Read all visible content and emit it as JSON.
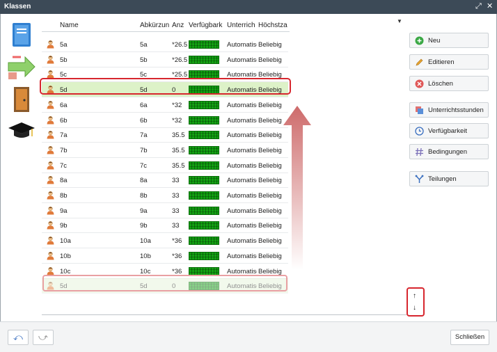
{
  "window": {
    "title": "Klassen",
    "maximize_icon": "expand-icon",
    "close_icon": "close-icon"
  },
  "nav_icons": [
    "book-icon",
    "transfer-icon",
    "door-icon",
    "graduation-cap-icon"
  ],
  "table": {
    "headers": [
      "Name",
      "Abkürzun",
      "Anz",
      "Verfügbark",
      "Unterrich",
      "Höchstza"
    ],
    "rows": [
      {
        "name": "5a",
        "abbr": "5a",
        "count": "*26.5",
        "unterricht": "Automatisc",
        "hoechst": "Beliebig"
      },
      {
        "name": "5b",
        "abbr": "5b",
        "count": "*26.5",
        "unterricht": "Automatisc",
        "hoechst": "Beliebig"
      },
      {
        "name": "5c",
        "abbr": "5c",
        "count": "*25.5",
        "unterricht": "Automatisc",
        "hoechst": "Beliebig"
      },
      {
        "name": "5d",
        "abbr": "5d",
        "count": "0",
        "unterricht": "Automatisc",
        "hoechst": "Beliebig"
      },
      {
        "name": "6a",
        "abbr": "6a",
        "count": "*32",
        "unterricht": "Automatisc",
        "hoechst": "Beliebig"
      },
      {
        "name": "6b",
        "abbr": "6b",
        "count": "*32",
        "unterricht": "Automatisc",
        "hoechst": "Beliebig"
      },
      {
        "name": "7a",
        "abbr": "7a",
        "count": "35.5",
        "unterricht": "Automatisc",
        "hoechst": "Beliebig"
      },
      {
        "name": "7b",
        "abbr": "7b",
        "count": "35.5",
        "unterricht": "Automatisc",
        "hoechst": "Beliebig"
      },
      {
        "name": "7c",
        "abbr": "7c",
        "count": "35.5",
        "unterricht": "Automatisc",
        "hoechst": "Beliebig"
      },
      {
        "name": "8a",
        "abbr": "8a",
        "count": "33",
        "unterricht": "Automatisc",
        "hoechst": "Beliebig"
      },
      {
        "name": "8b",
        "abbr": "8b",
        "count": "33",
        "unterricht": "Automatisc",
        "hoechst": "Beliebig"
      },
      {
        "name": "9a",
        "abbr": "9a",
        "count": "33",
        "unterricht": "Automatisc",
        "hoechst": "Beliebig"
      },
      {
        "name": "9b",
        "abbr": "9b",
        "count": "33",
        "unterricht": "Automatisc",
        "hoechst": "Beliebig"
      },
      {
        "name": "10a",
        "abbr": "10a",
        "count": "*36",
        "unterricht": "Automatisc",
        "hoechst": "Beliebig"
      },
      {
        "name": "10b",
        "abbr": "10b",
        "count": "*36",
        "unterricht": "Automatisc",
        "hoechst": "Beliebig"
      },
      {
        "name": "10c",
        "abbr": "10c",
        "count": "*36",
        "unterricht": "Automatisc",
        "hoechst": "Beliebig"
      }
    ],
    "selected_index": 3,
    "ghost_row": {
      "name": "5d",
      "abbr": "5d",
      "count": "0",
      "unterricht": "Automatisc",
      "hoechst": "Beliebig"
    }
  },
  "actions": [
    {
      "label": "Neu",
      "icon": "plus-circle-icon"
    },
    {
      "label": "Editieren",
      "icon": "pencil-icon"
    },
    {
      "label": "Löschen",
      "icon": "delete-circle-icon"
    },
    {
      "label": "Unterrichtsstunden",
      "icon": "lessons-icon"
    },
    {
      "label": "Verfügbarkeit",
      "icon": "clock-icon"
    },
    {
      "label": "Bedingungen",
      "icon": "hash-icon"
    },
    {
      "label": "Teilungen",
      "icon": "split-icon"
    }
  ],
  "reorder": {
    "up": "↑",
    "down": "↓"
  },
  "footer": {
    "undo": "⤺",
    "redo": "⤻",
    "close_label": "Schließen"
  },
  "colors": {
    "titlebar": "#3c4a57",
    "selection": "#ddf2c8",
    "highlight": "#d7262e",
    "availability": "#12a112"
  }
}
